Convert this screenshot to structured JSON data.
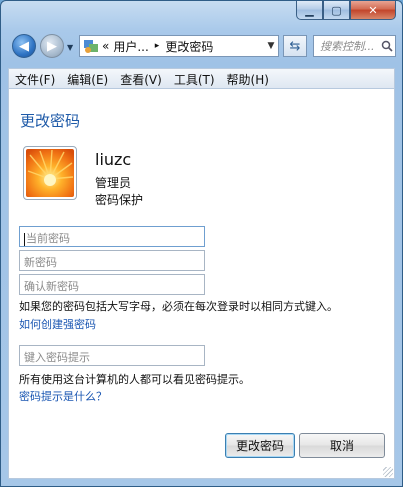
{
  "window": {
    "caption_buttons": {
      "minimize": "▁",
      "maximize": "▢",
      "close": "✕"
    },
    "colors": {
      "title_blue": "#1e5aa8",
      "link_blue": "#1a56b2",
      "frame": "#a9c9ea"
    }
  },
  "nav": {
    "back_icon": "arrow-left-icon",
    "forward_icon": "arrow-right-icon",
    "address": {
      "prefix": "«",
      "segment1": "用户...",
      "separator": "▸",
      "segment2": "更改密码"
    },
    "search_placeholder": "搜索控制..."
  },
  "menu": [
    "文件(F)",
    "编辑(E)",
    "查看(V)",
    "工具(T)",
    "帮助(H)"
  ],
  "page": {
    "title": "更改密码",
    "user": {
      "name": "liuzc",
      "role": "管理员",
      "status": "密码保护"
    },
    "fields": {
      "current_password": "当前密码",
      "new_password": "新密码",
      "confirm_password": "确认新密码",
      "hint": "键入密码提示"
    },
    "case_note": "如果您的密码包括大写字母，必须在每次登录时以相同方式键入。",
    "strong_link": "如何创建强密码",
    "hint_note": "所有使用这台计算机的人都可以看见密码提示。",
    "hint_link": "密码提示是什么？"
  },
  "buttons": {
    "change": "更改密码",
    "cancel": "取消"
  }
}
